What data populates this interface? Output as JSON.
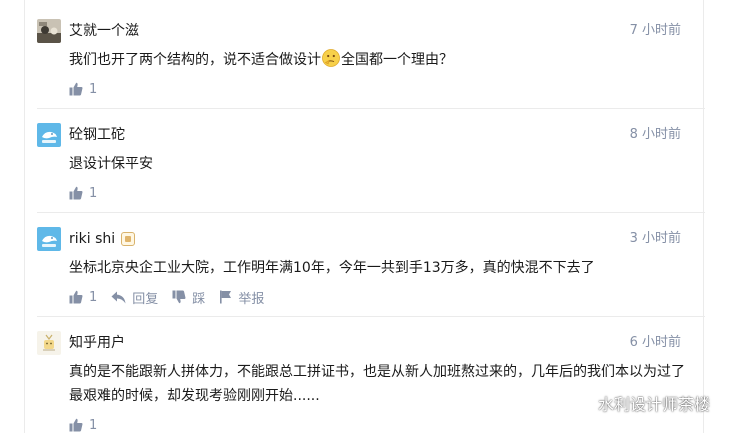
{
  "colors": {
    "text": "#1a1a1a",
    "meta": "#8590a6",
    "divider": "#ebebeb",
    "badge": "#e0b46a"
  },
  "comments": [
    {
      "author": "艾就一个滋",
      "time": "7 小时前",
      "content_before": "我们也开了两个结构的，说不适合做设计",
      "emoji": "thinking-emoji",
      "content_after": "全国都一个理由？",
      "likes": "1"
    },
    {
      "author": "砼钢工砣",
      "time": "8 小时前",
      "content": "退设计保平安",
      "likes": "1"
    },
    {
      "author": "riki shi",
      "badge": "member-badge-icon",
      "time": "3 小时前",
      "content": "坐标北京央企工业大院，工作明年满10年，今年一共到手13万多，真的快混不下去了",
      "likes": "1",
      "reply_label": "回复",
      "dislike_label": "踩",
      "report_label": "举报"
    },
    {
      "author": "知乎用户",
      "time": "6 小时前",
      "content": "真的是不能跟新人拼体力，不能跟总工拼证书，也是从新人加班熬过来的，几年后的我们本以为过了最艰难的时候，却发现考验刚刚开始......",
      "likes": "1"
    }
  ],
  "watermark": {
    "icon": "wechat-icon",
    "text": "水利设计师茶楼"
  }
}
